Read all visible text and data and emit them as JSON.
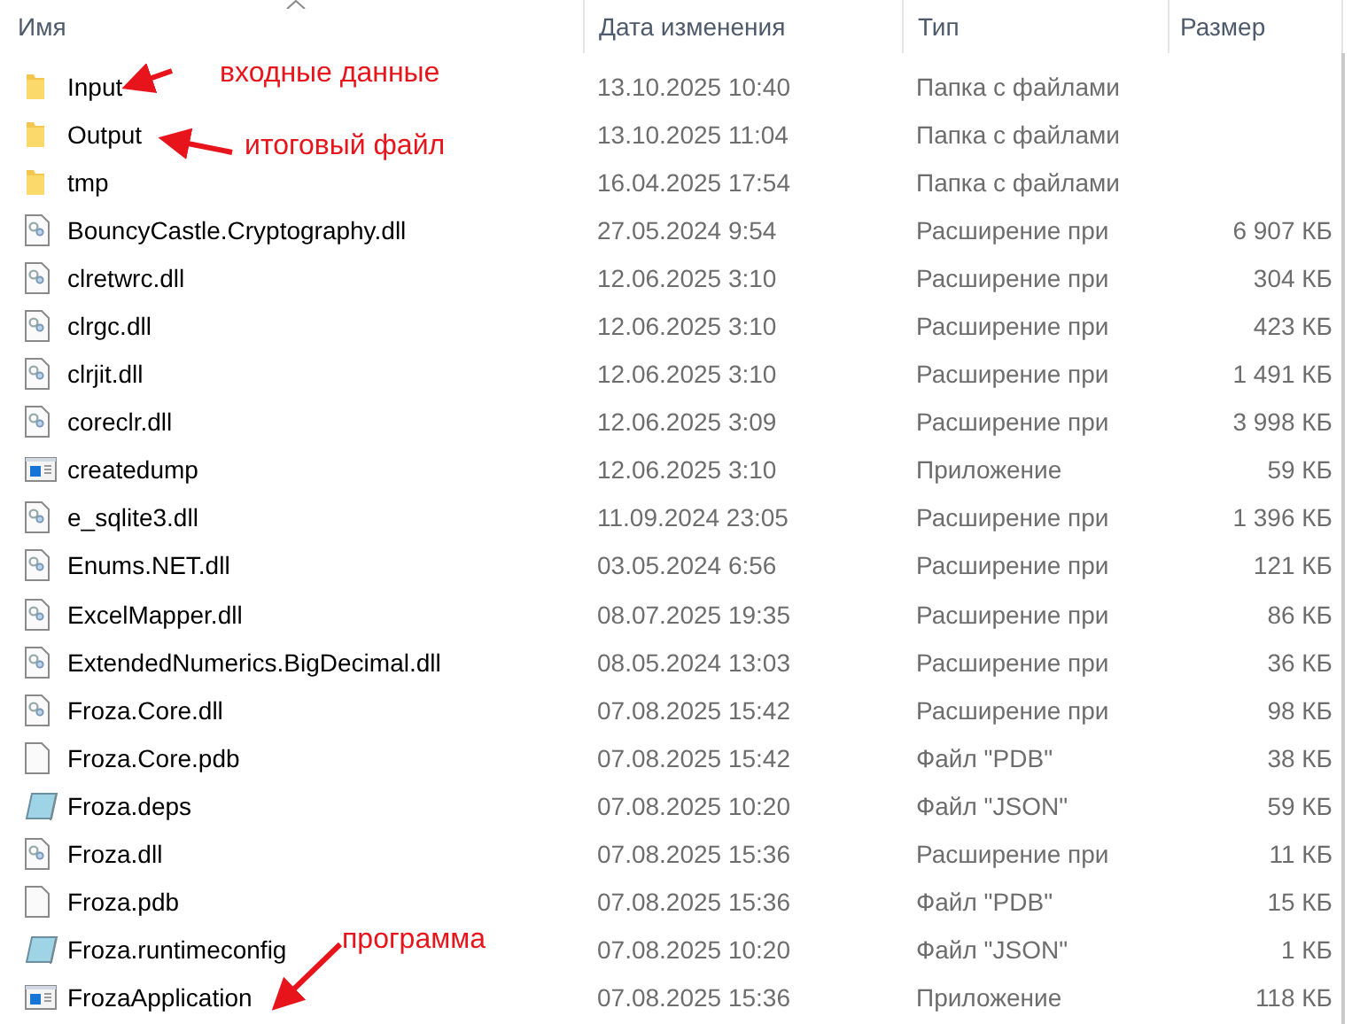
{
  "columns": [
    "Имя",
    "Дата изменения",
    "Тип",
    "Размер"
  ],
  "rows": [
    {
      "kind": "folder",
      "name": "Input",
      "date": "13.10.2025 10:40",
      "type": "Папка с файлами"
    },
    {
      "kind": "folder",
      "name": "Output",
      "date": "13.10.2025 11:04",
      "type": "Папка с файлами"
    },
    {
      "kind": "folder",
      "name": "tmp",
      "date": "16.04.2025 17:54",
      "type": "Папка с файлами"
    },
    {
      "kind": "dll",
      "name": "BouncyCastle.Cryptography.dll",
      "date": "27.05.2024 9:54",
      "type": "Расширение при",
      "size": "6 907 КБ"
    },
    {
      "kind": "dll",
      "name": "clretwrc.dll",
      "date": "12.06.2025 3:10",
      "type": "Расширение при",
      "size": "304 КБ"
    },
    {
      "kind": "dll",
      "name": "clrgc.dll",
      "date": "12.06.2025 3:10",
      "type": "Расширение при",
      "size": "423 КБ"
    },
    {
      "kind": "dll",
      "name": "clrjit.dll",
      "date": "12.06.2025 3:10",
      "type": "Расширение при",
      "size": "1 491 КБ"
    },
    {
      "kind": "dll",
      "name": "coreclr.dll",
      "date": "12.06.2025 3:09",
      "type": "Расширение при",
      "size": "3 998 КБ"
    },
    {
      "kind": "app",
      "name": "createdump",
      "date": "12.06.2025 3:10",
      "type": "Приложение",
      "size": "59 КБ"
    },
    {
      "kind": "dll",
      "name": "e_sqlite3.dll",
      "date": "11.09.2024 23:05",
      "type": "Расширение при",
      "size": "1 396 КБ"
    },
    {
      "kind": "dll",
      "name": "Enums.NET.dll",
      "date": "03.05.2024 6:56",
      "type": "Расширение при",
      "size": "121 КБ"
    },
    {
      "kind": "dll",
      "name": "ExcelMapper.dll",
      "date": "08.07.2025 19:35",
      "type": "Расширение при",
      "size": "86 КБ"
    },
    {
      "kind": "dll",
      "name": "ExtendedNumerics.BigDecimal.dll",
      "date": "08.05.2024 13:03",
      "type": "Расширение при",
      "size": "36 КБ"
    },
    {
      "kind": "dll",
      "name": "Froza.Core.dll",
      "date": "07.08.2025 15:42",
      "type": "Расширение при",
      "size": "98 КБ"
    },
    {
      "kind": "file",
      "name": "Froza.Core.pdb",
      "date": "07.08.2025 15:42",
      "type": "Файл \"PDB\"",
      "size": "38 КБ"
    },
    {
      "kind": "json",
      "name": "Froza.deps",
      "date": "07.08.2025 10:20",
      "type": "Файл \"JSON\"",
      "size": "59 КБ"
    },
    {
      "kind": "dll",
      "name": "Froza.dll",
      "date": "07.08.2025 15:36",
      "type": "Расширение при",
      "size": "11 КБ"
    },
    {
      "kind": "file",
      "name": "Froza.pdb",
      "date": "07.08.2025 15:36",
      "type": "Файл \"PDB\"",
      "size": "15 КБ"
    },
    {
      "kind": "json",
      "name": "Froza.runtimeconfig",
      "date": "07.08.2025 10:20",
      "type": "Файл \"JSON\"",
      "size": "1 КБ"
    },
    {
      "kind": "app",
      "name": "FrozaApplication",
      "date": "07.08.2025 15:36",
      "type": "Приложение",
      "size": "118 КБ"
    }
  ],
  "annotations": [
    "входные данные",
    "итоговый файл",
    "программа"
  ]
}
